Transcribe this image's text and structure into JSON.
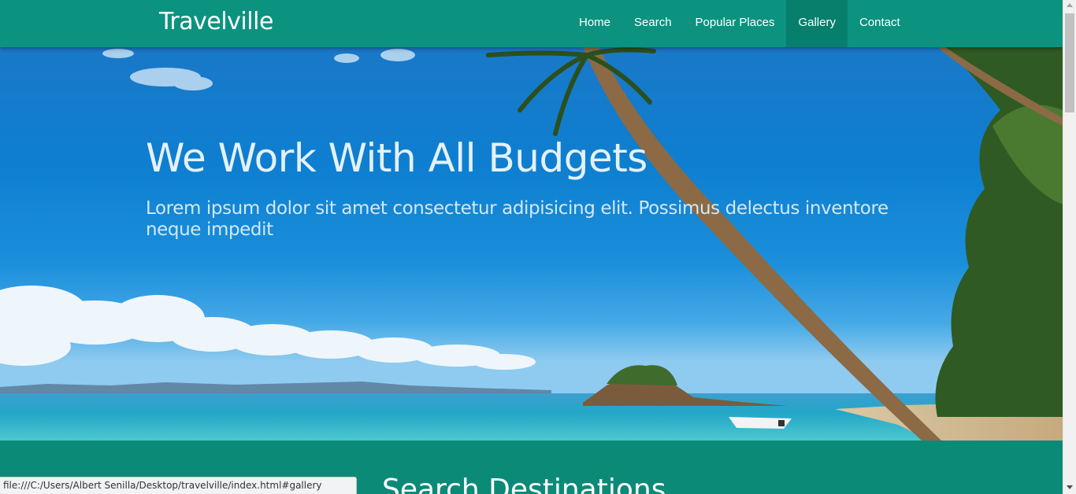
{
  "brand": {
    "name": "Travelville"
  },
  "nav": {
    "items": [
      {
        "label": "Home",
        "active": false
      },
      {
        "label": "Search",
        "active": false
      },
      {
        "label": "Popular Places",
        "active": false
      },
      {
        "label": "Gallery",
        "active": true
      },
      {
        "label": "Contact",
        "active": false
      }
    ]
  },
  "hero": {
    "title": "We Work With All Budgets",
    "subtitle": "Lorem ipsum dolor sit amet consectetur adipisicing elit. Possimus delectus inventore neque impedit",
    "image_icon": "tropical-beach-image"
  },
  "search_section": {
    "title": "Search Destinations"
  },
  "status_bar": {
    "url": "file:///C:/Users/Albert Senilla/Desktop/travelville/index.html#gallery"
  },
  "colors": {
    "navbar": "#0b937f",
    "nav_active": "#077f6d",
    "section_bg": "#0b8a77",
    "hero_text": "#e4f1fb"
  }
}
